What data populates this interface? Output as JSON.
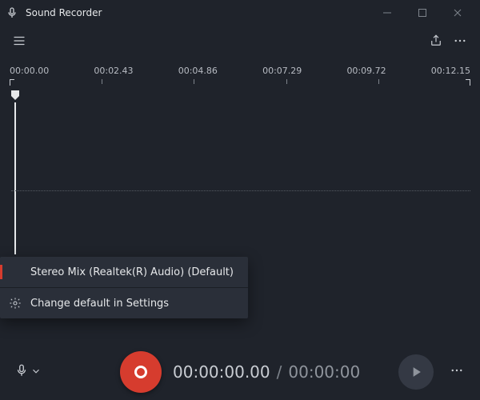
{
  "app": {
    "title": "Sound Recorder"
  },
  "ruler": {
    "labels": [
      "00:00.00",
      "00:02.43",
      "00:04.86",
      "00:07.29",
      "00:09.72",
      "00:12.15"
    ]
  },
  "popup": {
    "selected": "Stereo Mix (Realtek(R) Audio) (Default)",
    "settings_link": "Change default in Settings"
  },
  "time": {
    "current": "00:00:00.00",
    "total": "00:00:00"
  },
  "icons": {
    "mic": "mic-icon",
    "chevron": "chevron-down-icon",
    "share": "share-icon",
    "more": "more-icon",
    "gear": "gear-icon",
    "hamburger": "hamburger-icon",
    "play": "play-icon",
    "record": "record-icon"
  }
}
